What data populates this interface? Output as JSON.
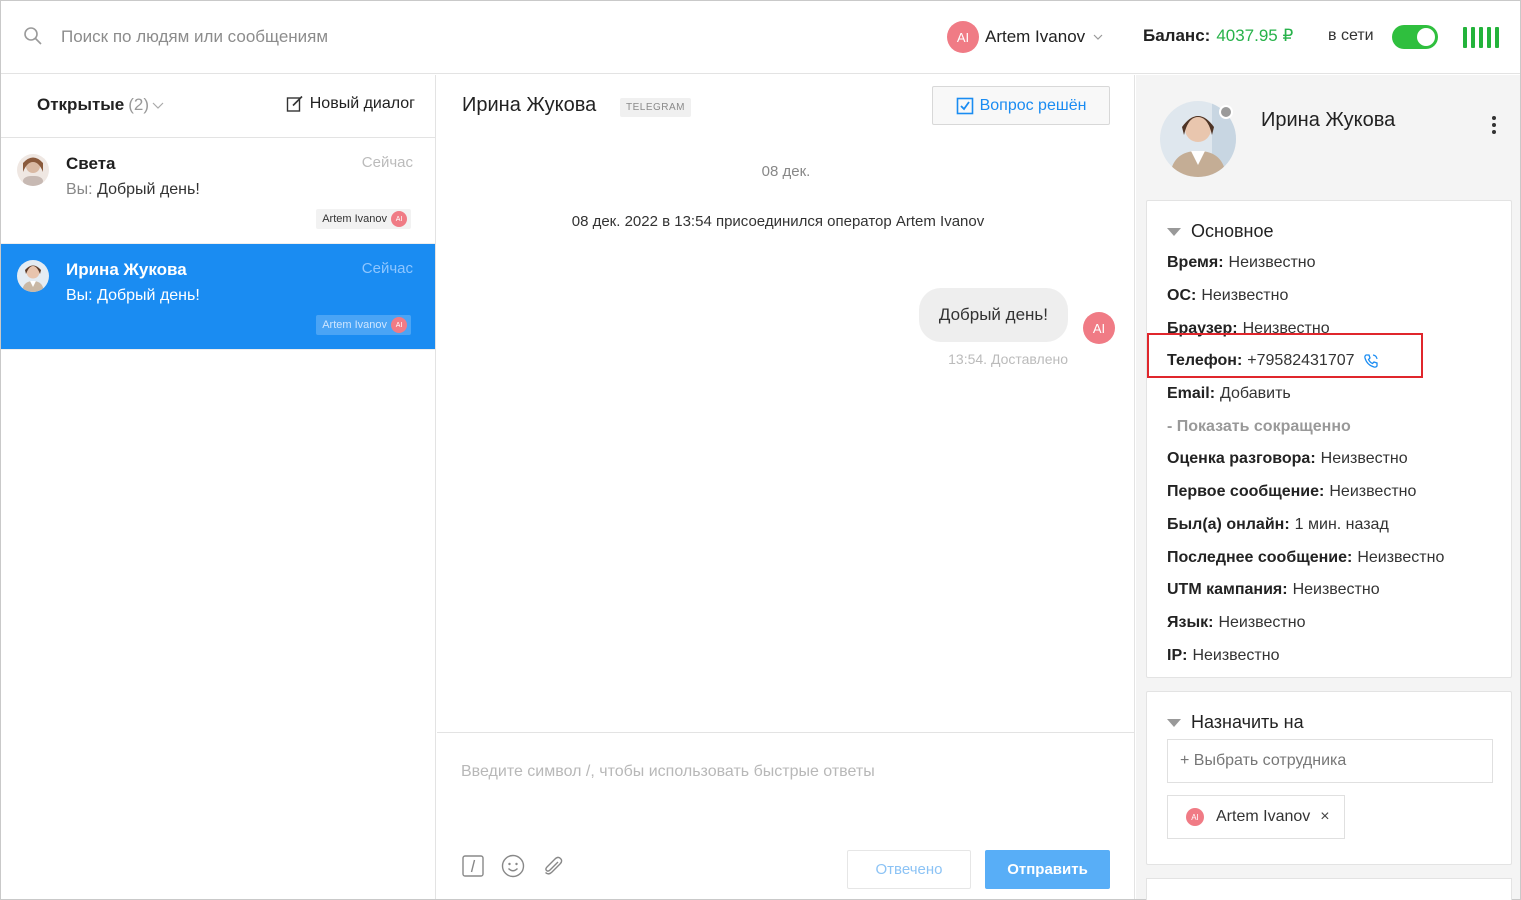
{
  "topbar": {
    "search_placeholder": "Поиск по людям или сообщениям",
    "user": {
      "initials": "AI",
      "name": "Artem Ivanov"
    },
    "balance_label": "Баланс:",
    "balance_value": "4037.95 ₽",
    "status_label": "в сети",
    "status_online": true
  },
  "left": {
    "filter_label": "Открытые",
    "filter_count": "(2)",
    "new_dialog_label": "Новый диалог",
    "dialogs": [
      {
        "name": "Света",
        "time": "Сейчас",
        "you_prefix": "Вы:",
        "message": "Добрый день!",
        "operator": "Artem Ivanov",
        "operator_initials": "AI",
        "active": false
      },
      {
        "name": "Ирина Жукова",
        "time": "Сейчас",
        "you_prefix": "Вы:",
        "message": "Добрый день!",
        "operator": "Artem Ivanov",
        "operator_initials": "AI",
        "active": true
      }
    ]
  },
  "chat": {
    "title": "Ирина Жукова",
    "channel": "TELEGRAM",
    "resolve_label": "Вопрос решён",
    "date_separator": "08 дек.",
    "system_message": "08 дек. 2022 в 13:54 присоединился оператор Artem Ivanov",
    "message": {
      "text": "Добрый день!",
      "meta": "13:54. Доставлено",
      "author_initials": "AI"
    },
    "composer_placeholder": "Введите символ /, чтобы использовать быстрые ответы",
    "answered_label": "Отвечено",
    "send_label": "Отправить"
  },
  "profile": {
    "name": "Ирина Жукова",
    "main_section_title": "Основное",
    "fields": [
      {
        "label": "Время:",
        "value": "Неизвестно"
      },
      {
        "label": "ОС:",
        "value": "Неизвестно"
      },
      {
        "label": "Браузер:",
        "value": "Неизвестно"
      },
      {
        "label": "Телефон:",
        "value": "+79582431707"
      },
      {
        "label": "Email:",
        "value": "Добавить"
      }
    ],
    "collapse_label": "- Показать сокращенно",
    "fields_more": [
      {
        "label": "Оценка разговора:",
        "value": "Неизвестно"
      },
      {
        "label": "Первое сообщение:",
        "value": "Неизвестно"
      },
      {
        "label": "Был(а) онлайн:",
        "value": "1 мин. назад"
      },
      {
        "label": "Последнее сообщение:",
        "value": "Неизвестно"
      },
      {
        "label": "UTM кампания:",
        "value": "Неизвестно"
      },
      {
        "label": "Язык:",
        "value": "Неизвестно"
      },
      {
        "label": "IP:",
        "value": "Неизвестно"
      }
    ],
    "assign_section_title": "Назначить на",
    "assign_placeholder": "+ Выбрать сотрудника",
    "assignee": {
      "initials": "AI",
      "name": "Artem Ivanov",
      "remove": "×"
    }
  },
  "colors": {
    "accent": "#1a8cf2",
    "online": "#2fbf3e",
    "balance": "#27b24a",
    "avatar": "#f07b85",
    "highlight": "#e0262c"
  }
}
